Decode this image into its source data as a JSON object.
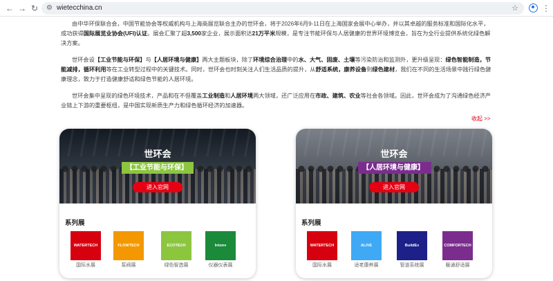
{
  "browser": {
    "url": "wietecchina.cn"
  },
  "intro": {
    "p1": [
      {
        "t": "由中华环保联合会，中国节能协会等权威机构与上海商展览联合主办的世环会，将于2026年6月9-11日在上海国家会展中心举办，并以其卓越的服务标准和国际化水平，成功获得"
      },
      {
        "t": "国际展览业协会(UFI)认证",
        "b": true
      },
      {
        "t": "。展会汇聚了超"
      },
      {
        "t": "3,500",
        "b": true
      },
      {
        "t": "家企业，展示面积达"
      },
      {
        "t": "21万平米",
        "b": true
      },
      {
        "t": "规模，是专注节能环保与人居健康的世界环境博览会，旨在为全行业提供系统化绿色解决方案。"
      }
    ],
    "p2": [
      {
        "t": "世环会设"
      },
      {
        "t": "【工业节能与环保】",
        "b": true
      },
      {
        "t": "与"
      },
      {
        "t": "【人居环境与健康】",
        "b": true
      },
      {
        "t": "两大主题板块，除了"
      },
      {
        "t": "环境综合治理",
        "b": true
      },
      {
        "t": "中的"
      },
      {
        "t": "水、大气、固废、土壤",
        "b": true
      },
      {
        "t": "等污染防治和监测外，更升级呈现："
      },
      {
        "t": "绿色智能制造，节能减排，循环利用",
        "b": true
      },
      {
        "t": "等在工业转型过程中的关键技术。同时，世环会也时刻关注人们生活品质的提升，从"
      },
      {
        "t": "舒适系统，康养设备",
        "b": true
      },
      {
        "t": "到"
      },
      {
        "t": "绿色建材",
        "b": true
      },
      {
        "t": "，我们在不同的生活场景中践行绿色健康理念，致力于打造健康舒适和绿色节能的人居环境。"
      }
    ],
    "p3": [
      {
        "t": "世环会集中呈现的绿色环境技术，产品和在不但覆盖"
      },
      {
        "t": "工业制造",
        "b": true
      },
      {
        "t": "和"
      },
      {
        "t": "人居环境",
        "b": true
      },
      {
        "t": "两大领域，还广泛应用在"
      },
      {
        "t": "市政、建筑、农业",
        "b": true
      },
      {
        "t": "等社会各领域。因此，世环会成为了沟通绿色经济产业链上下游的重要枢纽，是中国实现新质生产力和绿色循环经济的加速器。"
      }
    ]
  },
  "more_link": "收起 >>",
  "cards": [
    {
      "title": "世环会",
      "tag": "【工业节能与环保】",
      "button": "进入官网",
      "series_title": "系列展",
      "logos": [
        {
          "text": "WATERTECH",
          "label": "国际水展",
          "color": "#d7000f"
        },
        {
          "text": "FLOWTECH",
          "label": "泵阀展",
          "color": "#f39800"
        },
        {
          "text": "ECOTECH",
          "label": "绿色智造展",
          "color": "#8cc63f"
        },
        {
          "text": "Intonv",
          "label": "仪器仪表展",
          "color": "#1b8a3a"
        }
      ]
    },
    {
      "title": "世环会",
      "tag": "【人居环境与健康】",
      "button": "进入官网",
      "series_title": "系列展",
      "logos": [
        {
          "text": "WATERTECH",
          "label": "国际水展",
          "color": "#d7000f"
        },
        {
          "text": "ALIVE",
          "label": "适老康养展",
          "color": "#3fa9f5"
        },
        {
          "text": "BuildEx",
          "label": "管道系统展",
          "color": "#1d2088"
        },
        {
          "text": "COMFORTECH",
          "label": "暖通舒适展",
          "color": "#7b2d8e"
        }
      ]
    }
  ]
}
